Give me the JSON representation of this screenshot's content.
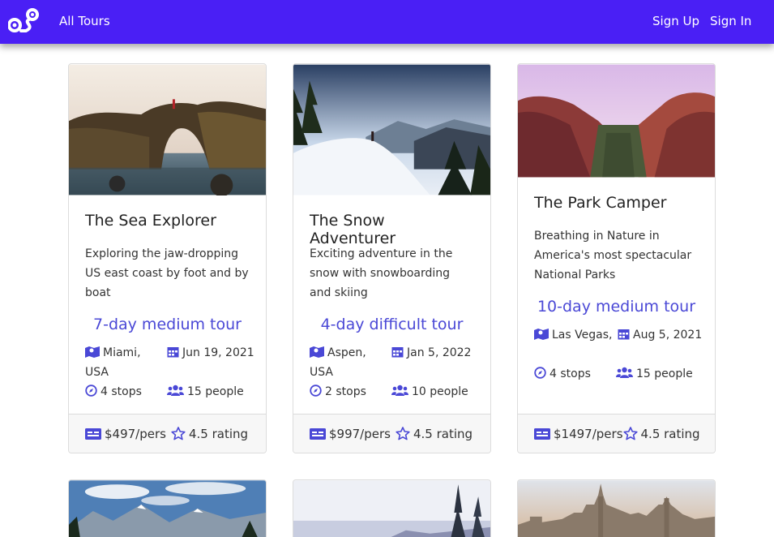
{
  "nav": {
    "all_tours": "All Tours",
    "sign_up": "Sign Up",
    "sign_in": "Sign In"
  },
  "colors": {
    "navbar": "#4a1ff5",
    "accent": "#4a48d6",
    "icon": "#4a48d6"
  },
  "tours": [
    {
      "title": "The Sea Explorer",
      "description": "Exploring the jaw-dropping US east coast by foot and by boat",
      "summary": "7-day medium tour",
      "location": "Miami, USA",
      "date": "Jun 19, 2021",
      "stops": "4 stops",
      "people": "15 people",
      "price": "$497/pers",
      "rating": "4.5 rating",
      "image": "sea-arch-photo"
    },
    {
      "title": "The Snow Adventurer",
      "description": "Exciting adventure in the snow with snowboarding and skiing",
      "summary": "4-day difficult tour",
      "location": "Aspen, USA",
      "date": "Jan 5, 2022",
      "stops": "2 stops",
      "people": "10 people",
      "price": "$997/pers",
      "rating": "4.5 rating",
      "image": "snow-mountain-photo"
    },
    {
      "title": "The Park Camper",
      "description": "Breathing in Nature in America's most spectacular National Parks",
      "summary": "10-day medium tour",
      "location": "Las Vegas, USA",
      "date": "Aug 5, 2021",
      "stops": "4 stops",
      "people": "15 people",
      "price": "$1497/pers",
      "rating": "4.5 rating",
      "image": "canyon-photo"
    }
  ],
  "next_row_images": [
    "mountain-lake-photo",
    "snowy-forest-photo",
    "city-skyline-photo"
  ]
}
